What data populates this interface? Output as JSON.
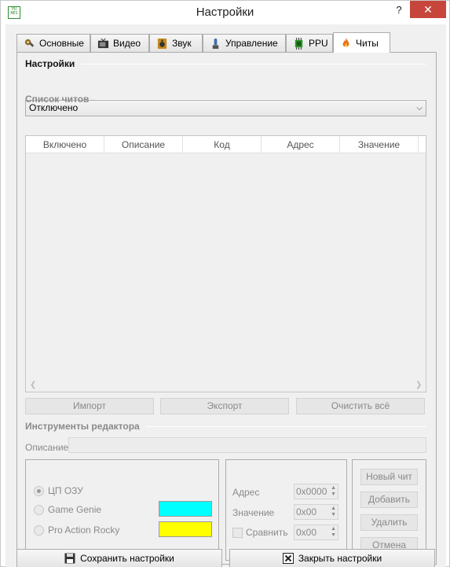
{
  "window": {
    "title": "Настройки",
    "app_icon_text": "PU NES",
    "help": "?",
    "close": "✕"
  },
  "tabs": [
    {
      "label": "Основные",
      "icon": "wrench-gear-icon"
    },
    {
      "label": "Видео",
      "icon": "tv-icon"
    },
    {
      "label": "Звук",
      "icon": "speaker-icon"
    },
    {
      "label": "Управление",
      "icon": "joystick-icon"
    },
    {
      "label": "PPU",
      "icon": "chip-icon"
    },
    {
      "label": "Читы",
      "icon": "fire-icon",
      "active": true
    }
  ],
  "settings": {
    "group_title": "Настройки",
    "mode_value": "Отключено"
  },
  "cheat_list": {
    "group_title": "Список читов",
    "columns": [
      "Включено",
      "Описание",
      "Код",
      "Адрес",
      "Значение"
    ],
    "rows": []
  },
  "list_buttons": {
    "import": "Импорт",
    "export": "Экспорт",
    "clear_all": "Очистить всё"
  },
  "editor": {
    "group_title": "Инструменты редактора",
    "description_label": "Описание",
    "description_value": "",
    "type_options": [
      {
        "label": "ЦП ОЗУ",
        "selected": true
      },
      {
        "label": "Game Genie",
        "selected": false,
        "color": "#00ffff"
      },
      {
        "label": "Pro Action Rocky",
        "selected": false,
        "color": "#ffff00"
      }
    ],
    "address_label": "Адрес",
    "address_value": "0x0000",
    "value_label": "Значение",
    "value_value": "0x00",
    "compare_label": "Сравнить",
    "compare_value": "0x00",
    "compare_checked": false,
    "actions": {
      "new_cheat": "Новый чит",
      "add": "Добавить",
      "delete": "Удалить",
      "cancel": "Отмена"
    }
  },
  "footer": {
    "save": "Сохранить настройки",
    "save_icon": "floppy-disk-icon",
    "close": "Закрыть настройки",
    "close_icon": "close-box-icon"
  }
}
